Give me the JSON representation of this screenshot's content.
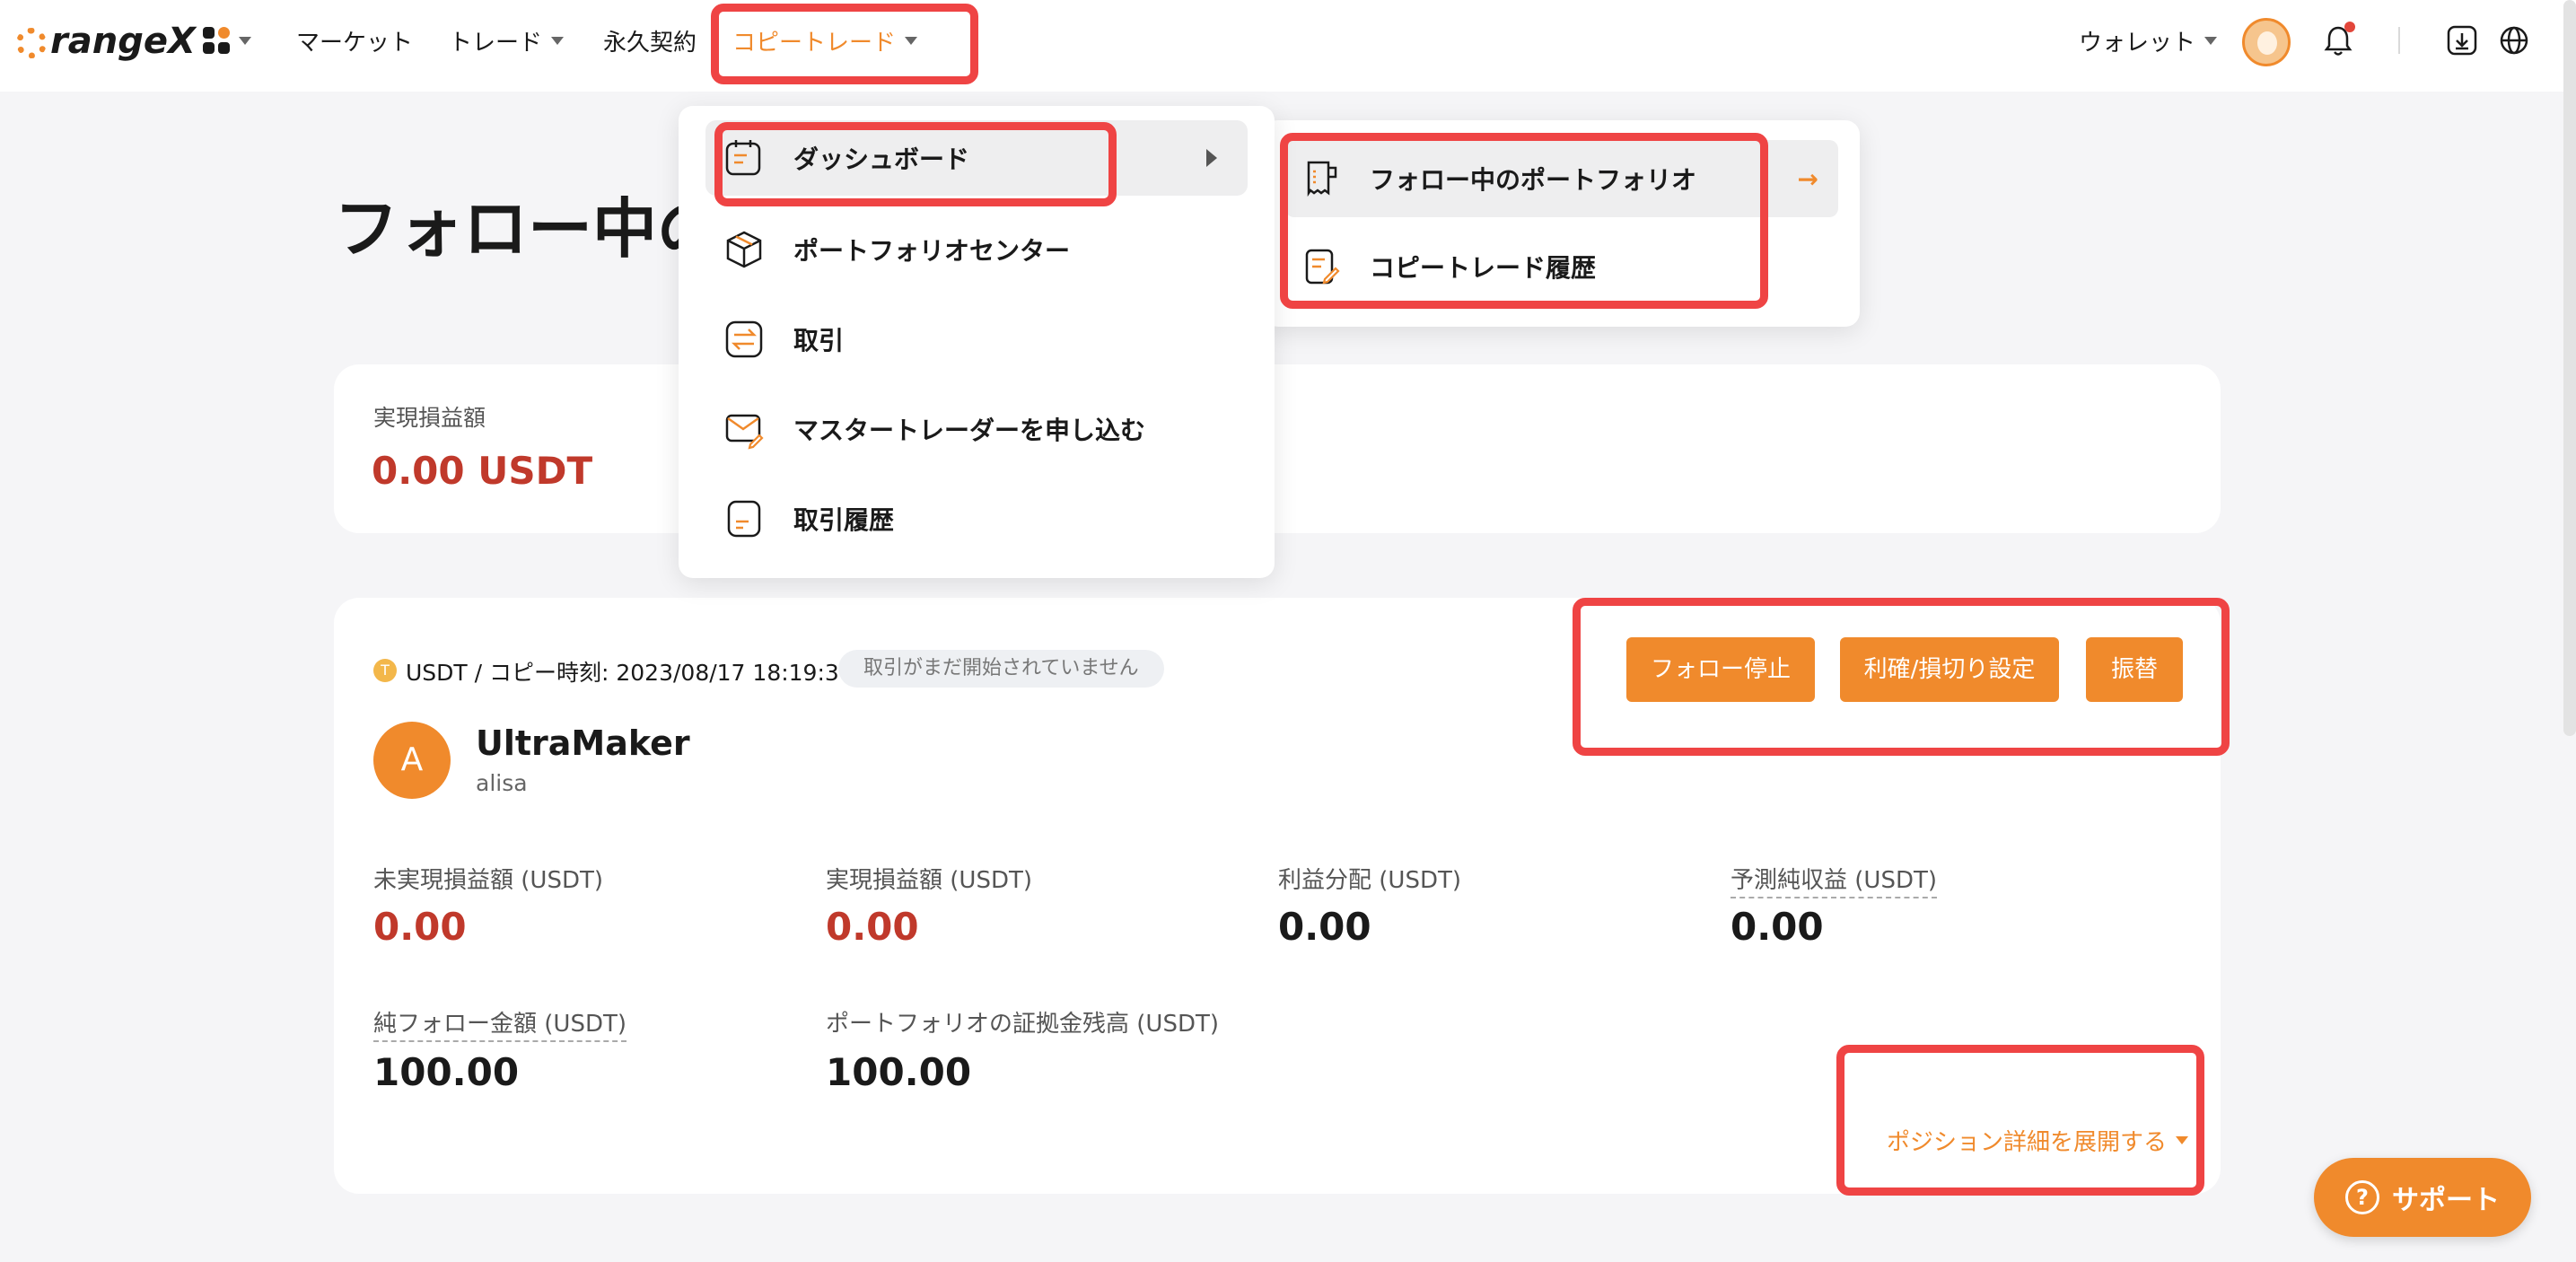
{
  "colors": {
    "accent": "#f08a2c",
    "negative": "#c0392b",
    "annotation": "#ef4444"
  },
  "nav": {
    "logo": "rangeX",
    "market": "マーケット",
    "trade": "トレード",
    "perpetual": "永久契約",
    "copy_trade": "コピートレード",
    "wallet": "ウォレット"
  },
  "page": {
    "title": "フォロー中の"
  },
  "pnl_summary": {
    "label": "実現損益額",
    "value": "0.00 USDT"
  },
  "portfolio": {
    "coin_symbol": "T",
    "copy_time": "USDT / コピー時刻: 2023/08/17 18:19:30",
    "status": "取引がまだ開始されていません",
    "avatar_letter": "A",
    "trader_name": "UltraMaker",
    "trader_id": "alisa",
    "buttons": {
      "stop_follow": "フォロー停止",
      "tp_sl": "利確/損切り設定",
      "transfer": "振替"
    },
    "stats": [
      {
        "label": "未実現損益額 (USDT)",
        "value": "0.00"
      },
      {
        "label": "実現損益額 (USDT)",
        "value": "0.00"
      },
      {
        "label": "利益分配 (USDT)",
        "value": "0.00"
      },
      {
        "label": "予測純収益 (USDT)",
        "value": "0.00"
      },
      {
        "label": "純フォロー金額 (USDT)",
        "value": "100.00"
      },
      {
        "label": "ポートフォリオの証拠金残高 (USDT)",
        "value": "100.00"
      }
    ],
    "expand_details": "ポジション詳細を展開する"
  },
  "copy_menu": {
    "items": [
      {
        "label": "ダッシュボード",
        "icon": "dashboard-icon"
      },
      {
        "label": "ポートフォリオセンター",
        "icon": "cube-icon"
      },
      {
        "label": "取引",
        "icon": "swap-icon"
      },
      {
        "label": "マスタートレーダーを申し込む",
        "icon": "mail-edit-icon"
      },
      {
        "label": "取引履歴",
        "icon": "history-icon"
      }
    ],
    "submenu": [
      {
        "label": "フォロー中のポートフォリオ",
        "icon": "receipt-icon"
      },
      {
        "label": "コピートレード履歴",
        "icon": "doc-edit-icon"
      }
    ]
  },
  "support": {
    "label": "サポート",
    "icon_glyph": "?"
  }
}
